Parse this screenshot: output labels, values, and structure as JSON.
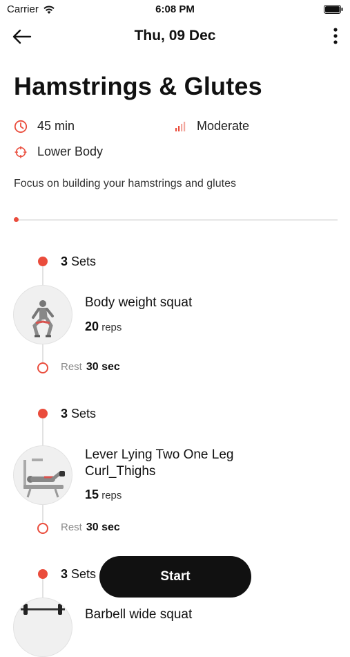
{
  "status_bar": {
    "carrier": "Carrier",
    "time": "6:08 PM"
  },
  "nav": {
    "title": "Thu, 09 Dec"
  },
  "workout": {
    "title": "Hamstrings & Glutes",
    "duration": "45 min",
    "intensity": "Moderate",
    "target": "Lower Body",
    "description": "Focus on building your hamstrings and glutes",
    "progress": 0
  },
  "exercises": [
    {
      "sets_count": "3",
      "sets_label": "Sets",
      "name": "Body weight squat",
      "reps_count": "20",
      "reps_label": "reps",
      "rest_label": "Rest",
      "rest_value": "30 sec"
    },
    {
      "sets_count": "3",
      "sets_label": "Sets",
      "name": "Lever Lying Two One Leg Curl_Thighs",
      "reps_count": "15",
      "reps_label": "reps",
      "rest_label": "Rest",
      "rest_value": "30 sec"
    },
    {
      "sets_count": "3",
      "sets_label": "Sets",
      "name": "Barbell wide squat"
    }
  ],
  "start_button": {
    "label": "Start"
  },
  "colors": {
    "accent": "#ea4c3c",
    "button": "#111111"
  }
}
